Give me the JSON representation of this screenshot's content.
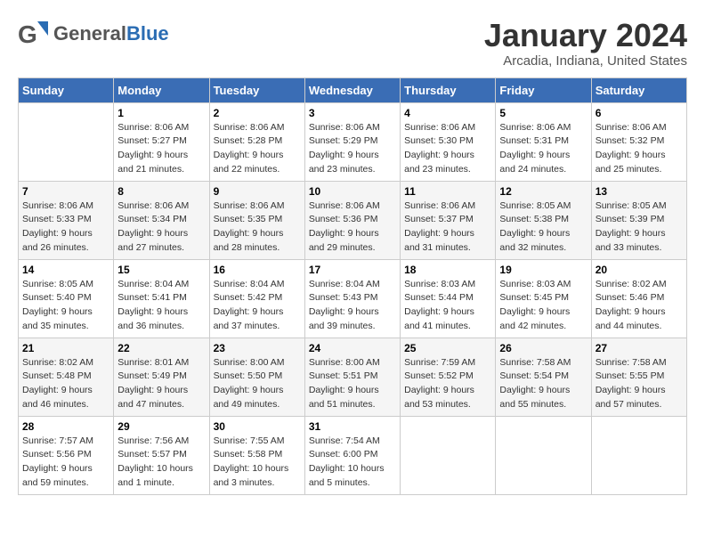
{
  "logo": {
    "general": "General",
    "blue": "Blue"
  },
  "title": "January 2024",
  "location": "Arcadia, Indiana, United States",
  "days_header": [
    "Sunday",
    "Monday",
    "Tuesday",
    "Wednesday",
    "Thursday",
    "Friday",
    "Saturday"
  ],
  "weeks": [
    [
      {
        "day": "",
        "info": ""
      },
      {
        "day": "1",
        "info": "Sunrise: 8:06 AM\nSunset: 5:27 PM\nDaylight: 9 hours\nand 21 minutes."
      },
      {
        "day": "2",
        "info": "Sunrise: 8:06 AM\nSunset: 5:28 PM\nDaylight: 9 hours\nand 22 minutes."
      },
      {
        "day": "3",
        "info": "Sunrise: 8:06 AM\nSunset: 5:29 PM\nDaylight: 9 hours\nand 23 minutes."
      },
      {
        "day": "4",
        "info": "Sunrise: 8:06 AM\nSunset: 5:30 PM\nDaylight: 9 hours\nand 23 minutes."
      },
      {
        "day": "5",
        "info": "Sunrise: 8:06 AM\nSunset: 5:31 PM\nDaylight: 9 hours\nand 24 minutes."
      },
      {
        "day": "6",
        "info": "Sunrise: 8:06 AM\nSunset: 5:32 PM\nDaylight: 9 hours\nand 25 minutes."
      }
    ],
    [
      {
        "day": "7",
        "info": "Sunrise: 8:06 AM\nSunset: 5:33 PM\nDaylight: 9 hours\nand 26 minutes."
      },
      {
        "day": "8",
        "info": "Sunrise: 8:06 AM\nSunset: 5:34 PM\nDaylight: 9 hours\nand 27 minutes."
      },
      {
        "day": "9",
        "info": "Sunrise: 8:06 AM\nSunset: 5:35 PM\nDaylight: 9 hours\nand 28 minutes."
      },
      {
        "day": "10",
        "info": "Sunrise: 8:06 AM\nSunset: 5:36 PM\nDaylight: 9 hours\nand 29 minutes."
      },
      {
        "day": "11",
        "info": "Sunrise: 8:06 AM\nSunset: 5:37 PM\nDaylight: 9 hours\nand 31 minutes."
      },
      {
        "day": "12",
        "info": "Sunrise: 8:05 AM\nSunset: 5:38 PM\nDaylight: 9 hours\nand 32 minutes."
      },
      {
        "day": "13",
        "info": "Sunrise: 8:05 AM\nSunset: 5:39 PM\nDaylight: 9 hours\nand 33 minutes."
      }
    ],
    [
      {
        "day": "14",
        "info": "Sunrise: 8:05 AM\nSunset: 5:40 PM\nDaylight: 9 hours\nand 35 minutes."
      },
      {
        "day": "15",
        "info": "Sunrise: 8:04 AM\nSunset: 5:41 PM\nDaylight: 9 hours\nand 36 minutes."
      },
      {
        "day": "16",
        "info": "Sunrise: 8:04 AM\nSunset: 5:42 PM\nDaylight: 9 hours\nand 37 minutes."
      },
      {
        "day": "17",
        "info": "Sunrise: 8:04 AM\nSunset: 5:43 PM\nDaylight: 9 hours\nand 39 minutes."
      },
      {
        "day": "18",
        "info": "Sunrise: 8:03 AM\nSunset: 5:44 PM\nDaylight: 9 hours\nand 41 minutes."
      },
      {
        "day": "19",
        "info": "Sunrise: 8:03 AM\nSunset: 5:45 PM\nDaylight: 9 hours\nand 42 minutes."
      },
      {
        "day": "20",
        "info": "Sunrise: 8:02 AM\nSunset: 5:46 PM\nDaylight: 9 hours\nand 44 minutes."
      }
    ],
    [
      {
        "day": "21",
        "info": "Sunrise: 8:02 AM\nSunset: 5:48 PM\nDaylight: 9 hours\nand 46 minutes."
      },
      {
        "day": "22",
        "info": "Sunrise: 8:01 AM\nSunset: 5:49 PM\nDaylight: 9 hours\nand 47 minutes."
      },
      {
        "day": "23",
        "info": "Sunrise: 8:00 AM\nSunset: 5:50 PM\nDaylight: 9 hours\nand 49 minutes."
      },
      {
        "day": "24",
        "info": "Sunrise: 8:00 AM\nSunset: 5:51 PM\nDaylight: 9 hours\nand 51 minutes."
      },
      {
        "day": "25",
        "info": "Sunrise: 7:59 AM\nSunset: 5:52 PM\nDaylight: 9 hours\nand 53 minutes."
      },
      {
        "day": "26",
        "info": "Sunrise: 7:58 AM\nSunset: 5:54 PM\nDaylight: 9 hours\nand 55 minutes."
      },
      {
        "day": "27",
        "info": "Sunrise: 7:58 AM\nSunset: 5:55 PM\nDaylight: 9 hours\nand 57 minutes."
      }
    ],
    [
      {
        "day": "28",
        "info": "Sunrise: 7:57 AM\nSunset: 5:56 PM\nDaylight: 9 hours\nand 59 minutes."
      },
      {
        "day": "29",
        "info": "Sunrise: 7:56 AM\nSunset: 5:57 PM\nDaylight: 10 hours\nand 1 minute."
      },
      {
        "day": "30",
        "info": "Sunrise: 7:55 AM\nSunset: 5:58 PM\nDaylight: 10 hours\nand 3 minutes."
      },
      {
        "day": "31",
        "info": "Sunrise: 7:54 AM\nSunset: 6:00 PM\nDaylight: 10 hours\nand 5 minutes."
      },
      {
        "day": "",
        "info": ""
      },
      {
        "day": "",
        "info": ""
      },
      {
        "day": "",
        "info": ""
      }
    ]
  ]
}
